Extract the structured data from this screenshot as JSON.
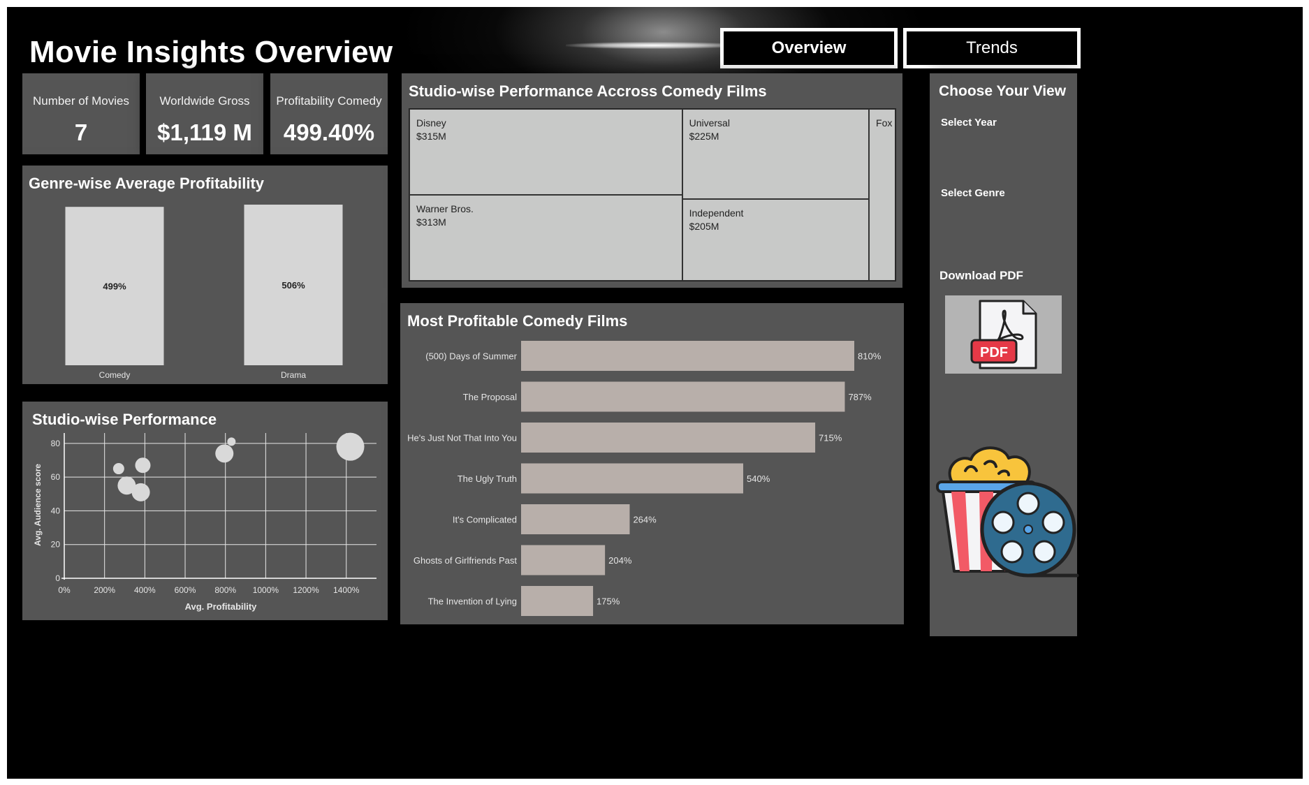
{
  "header": {
    "title": "Movie Insights Overview",
    "tabs": [
      "Overview",
      "Trends"
    ]
  },
  "kpis": [
    {
      "label": "Number of Movies",
      "value": "7"
    },
    {
      "label": "Worldwide Gross",
      "value": "$1,119 M"
    },
    {
      "label": "Profitability Comedy",
      "value": "499.40%"
    }
  ],
  "sidebar": {
    "title": "Choose Your View",
    "select_year": "Select Year",
    "select_genre": "Select Genre",
    "download": "Download PDF",
    "pdf_icon_text": "PDF"
  },
  "colors": {
    "background": "#000000",
    "card": "#555555",
    "bar_genre": "#d6d6d6",
    "bar_films": "#b8afaa",
    "treemap": "#c8c9c8",
    "bubble": "#d9d9d9"
  },
  "icons": [
    "pdf-file-icon",
    "popcorn-film-reel-icon"
  ],
  "chart_data": [
    {
      "type": "bar",
      "title": "Genre-wise Average Profitability",
      "categories": [
        "Comedy",
        "Drama"
      ],
      "values": [
        499,
        506
      ],
      "labels": [
        "499%",
        "506%"
      ],
      "ylim": [
        0,
        506
      ]
    },
    {
      "type": "scatter",
      "title": "Studio-wise Performance",
      "xlabel": "Avg. Profitability",
      "ylabel": "Avg. Audience score",
      "xticks": [
        "0%",
        "200%",
        "400%",
        "600%",
        "800%",
        "1000%",
        "1200%",
        "1400%"
      ],
      "yticks": [
        "0",
        "20",
        "40",
        "60",
        "80"
      ],
      "xlim": [
        0,
        1550
      ],
      "ylim": [
        0,
        82
      ],
      "points": [
        {
          "x": 270,
          "y": 65,
          "size": 8
        },
        {
          "x": 390,
          "y": 67,
          "size": 11
        },
        {
          "x": 310,
          "y": 55,
          "size": 13
        },
        {
          "x": 380,
          "y": 51,
          "size": 13
        },
        {
          "x": 830,
          "y": 81,
          "size": 6
        },
        {
          "x": 795,
          "y": 74,
          "size": 13
        },
        {
          "x": 1420,
          "y": 78,
          "size": 20
        }
      ]
    },
    {
      "type": "treemap",
      "title": "Studio-wise Performance Accross Comedy Films",
      "items": [
        {
          "name": "Disney",
          "value": 315,
          "label": "$315M"
        },
        {
          "name": "Warner Bros.",
          "value": 313,
          "label": "$313M"
        },
        {
          "name": "Universal",
          "value": 225,
          "label": "$225M"
        },
        {
          "name": "Independent",
          "value": 205,
          "label": "$205M"
        },
        {
          "name": "Fox",
          "value": 61,
          "label": ""
        }
      ]
    },
    {
      "type": "bar",
      "orientation": "horizontal",
      "title": "Most Profitable Comedy Films",
      "categories": [
        "(500) Days of Summer",
        "The Proposal",
        "He's Just Not That Into You",
        "The Ugly Truth",
        "It's Complicated",
        "Ghosts of Girlfriends Past",
        "The Invention of Lying"
      ],
      "values": [
        810,
        787,
        715,
        540,
        264,
        204,
        175
      ],
      "labels": [
        "810%",
        "787%",
        "715%",
        "540%",
        "264%",
        "204%",
        "175%"
      ],
      "xlim": [
        0,
        810
      ]
    }
  ]
}
